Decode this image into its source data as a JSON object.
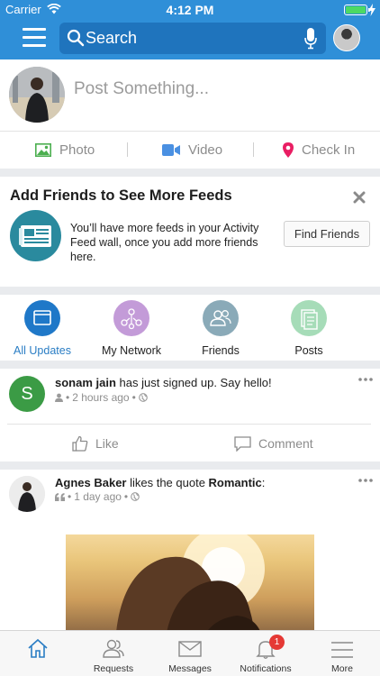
{
  "status_bar": {
    "carrier": "Carrier",
    "time": "4:12 PM"
  },
  "nav": {
    "search_placeholder": "Search"
  },
  "composer": {
    "placeholder": "Post Something...",
    "actions": [
      {
        "label": "Photo",
        "icon": "photo-icon",
        "color": "#4caf50"
      },
      {
        "label": "Video",
        "icon": "video-icon",
        "color": "#4a90e2"
      },
      {
        "label": "Check In",
        "icon": "location-pin-icon",
        "color": "#e91e63"
      }
    ]
  },
  "add_friends": {
    "title": "Add Friends to See More Feeds",
    "description": "You’ll have more feeds in your Activity Feed wall, once you add more friends here.",
    "button": "Find Friends"
  },
  "filters": [
    {
      "label": "All Updates",
      "active": true,
      "color": "#1f78c8"
    },
    {
      "label": "My Network",
      "active": false,
      "color": "#c39bd8"
    },
    {
      "label": "Friends",
      "active": false,
      "color": "#8aaab8"
    },
    {
      "label": "Posts",
      "active": false,
      "color": "#a6dcb8"
    }
  ],
  "activities": [
    {
      "author": "sonam jain",
      "action": " has just signed up. Say hello!",
      "avatar_letter": "S",
      "time": "2 hours ago",
      "like_label": "Like",
      "comment_label": "Comment"
    },
    {
      "author": "Agnes Baker",
      "action": " likes the quote ",
      "object": "Romantic",
      "suffix": ":",
      "time": "1 day ago"
    }
  ],
  "tabbar": [
    {
      "label": "",
      "icon": "home-icon",
      "active": true
    },
    {
      "label": "Requests",
      "icon": "users-icon",
      "active": false
    },
    {
      "label": "Messages",
      "icon": "envelope-icon",
      "active": false
    },
    {
      "label": "Notifications",
      "icon": "bell-icon",
      "active": false,
      "badge": "1"
    },
    {
      "label": "More",
      "icon": "menu-icon",
      "active": false
    }
  ]
}
